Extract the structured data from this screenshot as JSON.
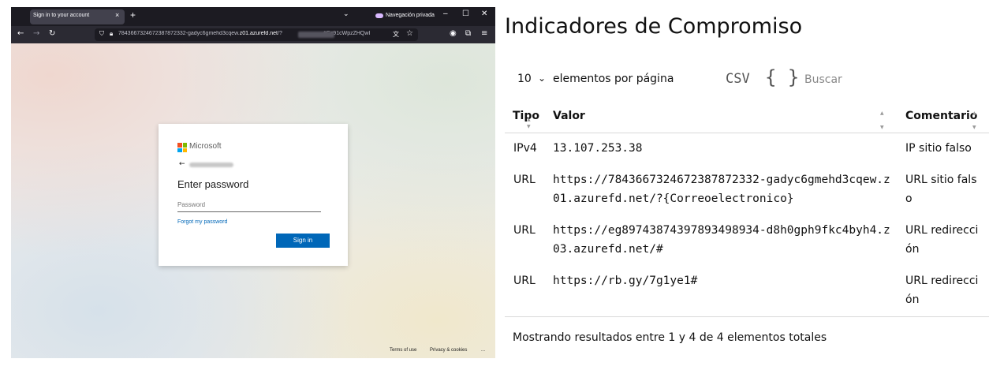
{
  "browser": {
    "tab_title": "Sign in to your account",
    "tab_close": "×",
    "new_tab": "+",
    "tabs_menu": "⌄",
    "private_label": "Navegación privada",
    "window_buttons": [
      "–",
      "☐",
      "✕"
    ],
    "nav_icons": [
      "arrow-left-icon",
      "arrow-right-icon",
      "reload-icon"
    ],
    "url_prefix": "7843667324672387872332-gadyc6gmehd3cqew.",
    "url_domain": "z01.azurefd.net",
    "url_after": "/?",
    "url_suffix": "#Cz91cWpzZHQwI"
  },
  "login": {
    "brand": "Microsoft",
    "title": "Enter password",
    "password_placeholder": "Password",
    "forgot_link": "Forgot my password",
    "signin_button": "Sign in",
    "brand_colors": [
      "#f25022",
      "#7fba00",
      "#00a4ef",
      "#ffb900"
    ],
    "accent": "#0067b8"
  },
  "page_footer": {
    "terms": "Terms of use",
    "privacy": "Privacy & cookies",
    "more": "..."
  },
  "panel": {
    "title": "Indicadores de Compromiso",
    "per_page_value": "10",
    "per_page_label": "elementos por página",
    "csv_label": "CSV",
    "json_label": "{ }",
    "search_placeholder": "Buscar",
    "columns": [
      "Tipo",
      "Valor",
      "Comentario"
    ],
    "rows": [
      {
        "tipo": "IPv4",
        "valor": "13.107.253.38",
        "comentario": "IP sitio falso"
      },
      {
        "tipo": "URL",
        "valor": "https://7843667324672387872332-gadyc6gmehd3cqew.z01.azurefd.net/?{Correoelectronico}",
        "comentario": "URL sitio falso"
      },
      {
        "tipo": "URL",
        "valor": "https://eg89743874397893498934-d8h0gph9fkc4byh4.z03.azurefd.net/#",
        "comentario": "URL redirección"
      },
      {
        "tipo": "URL",
        "valor": "https://rb.gy/7g1ye1#",
        "comentario": "URL redirección"
      }
    ],
    "summary": "Mostrando resultados entre 1 y 4 de 4 elementos totales"
  }
}
